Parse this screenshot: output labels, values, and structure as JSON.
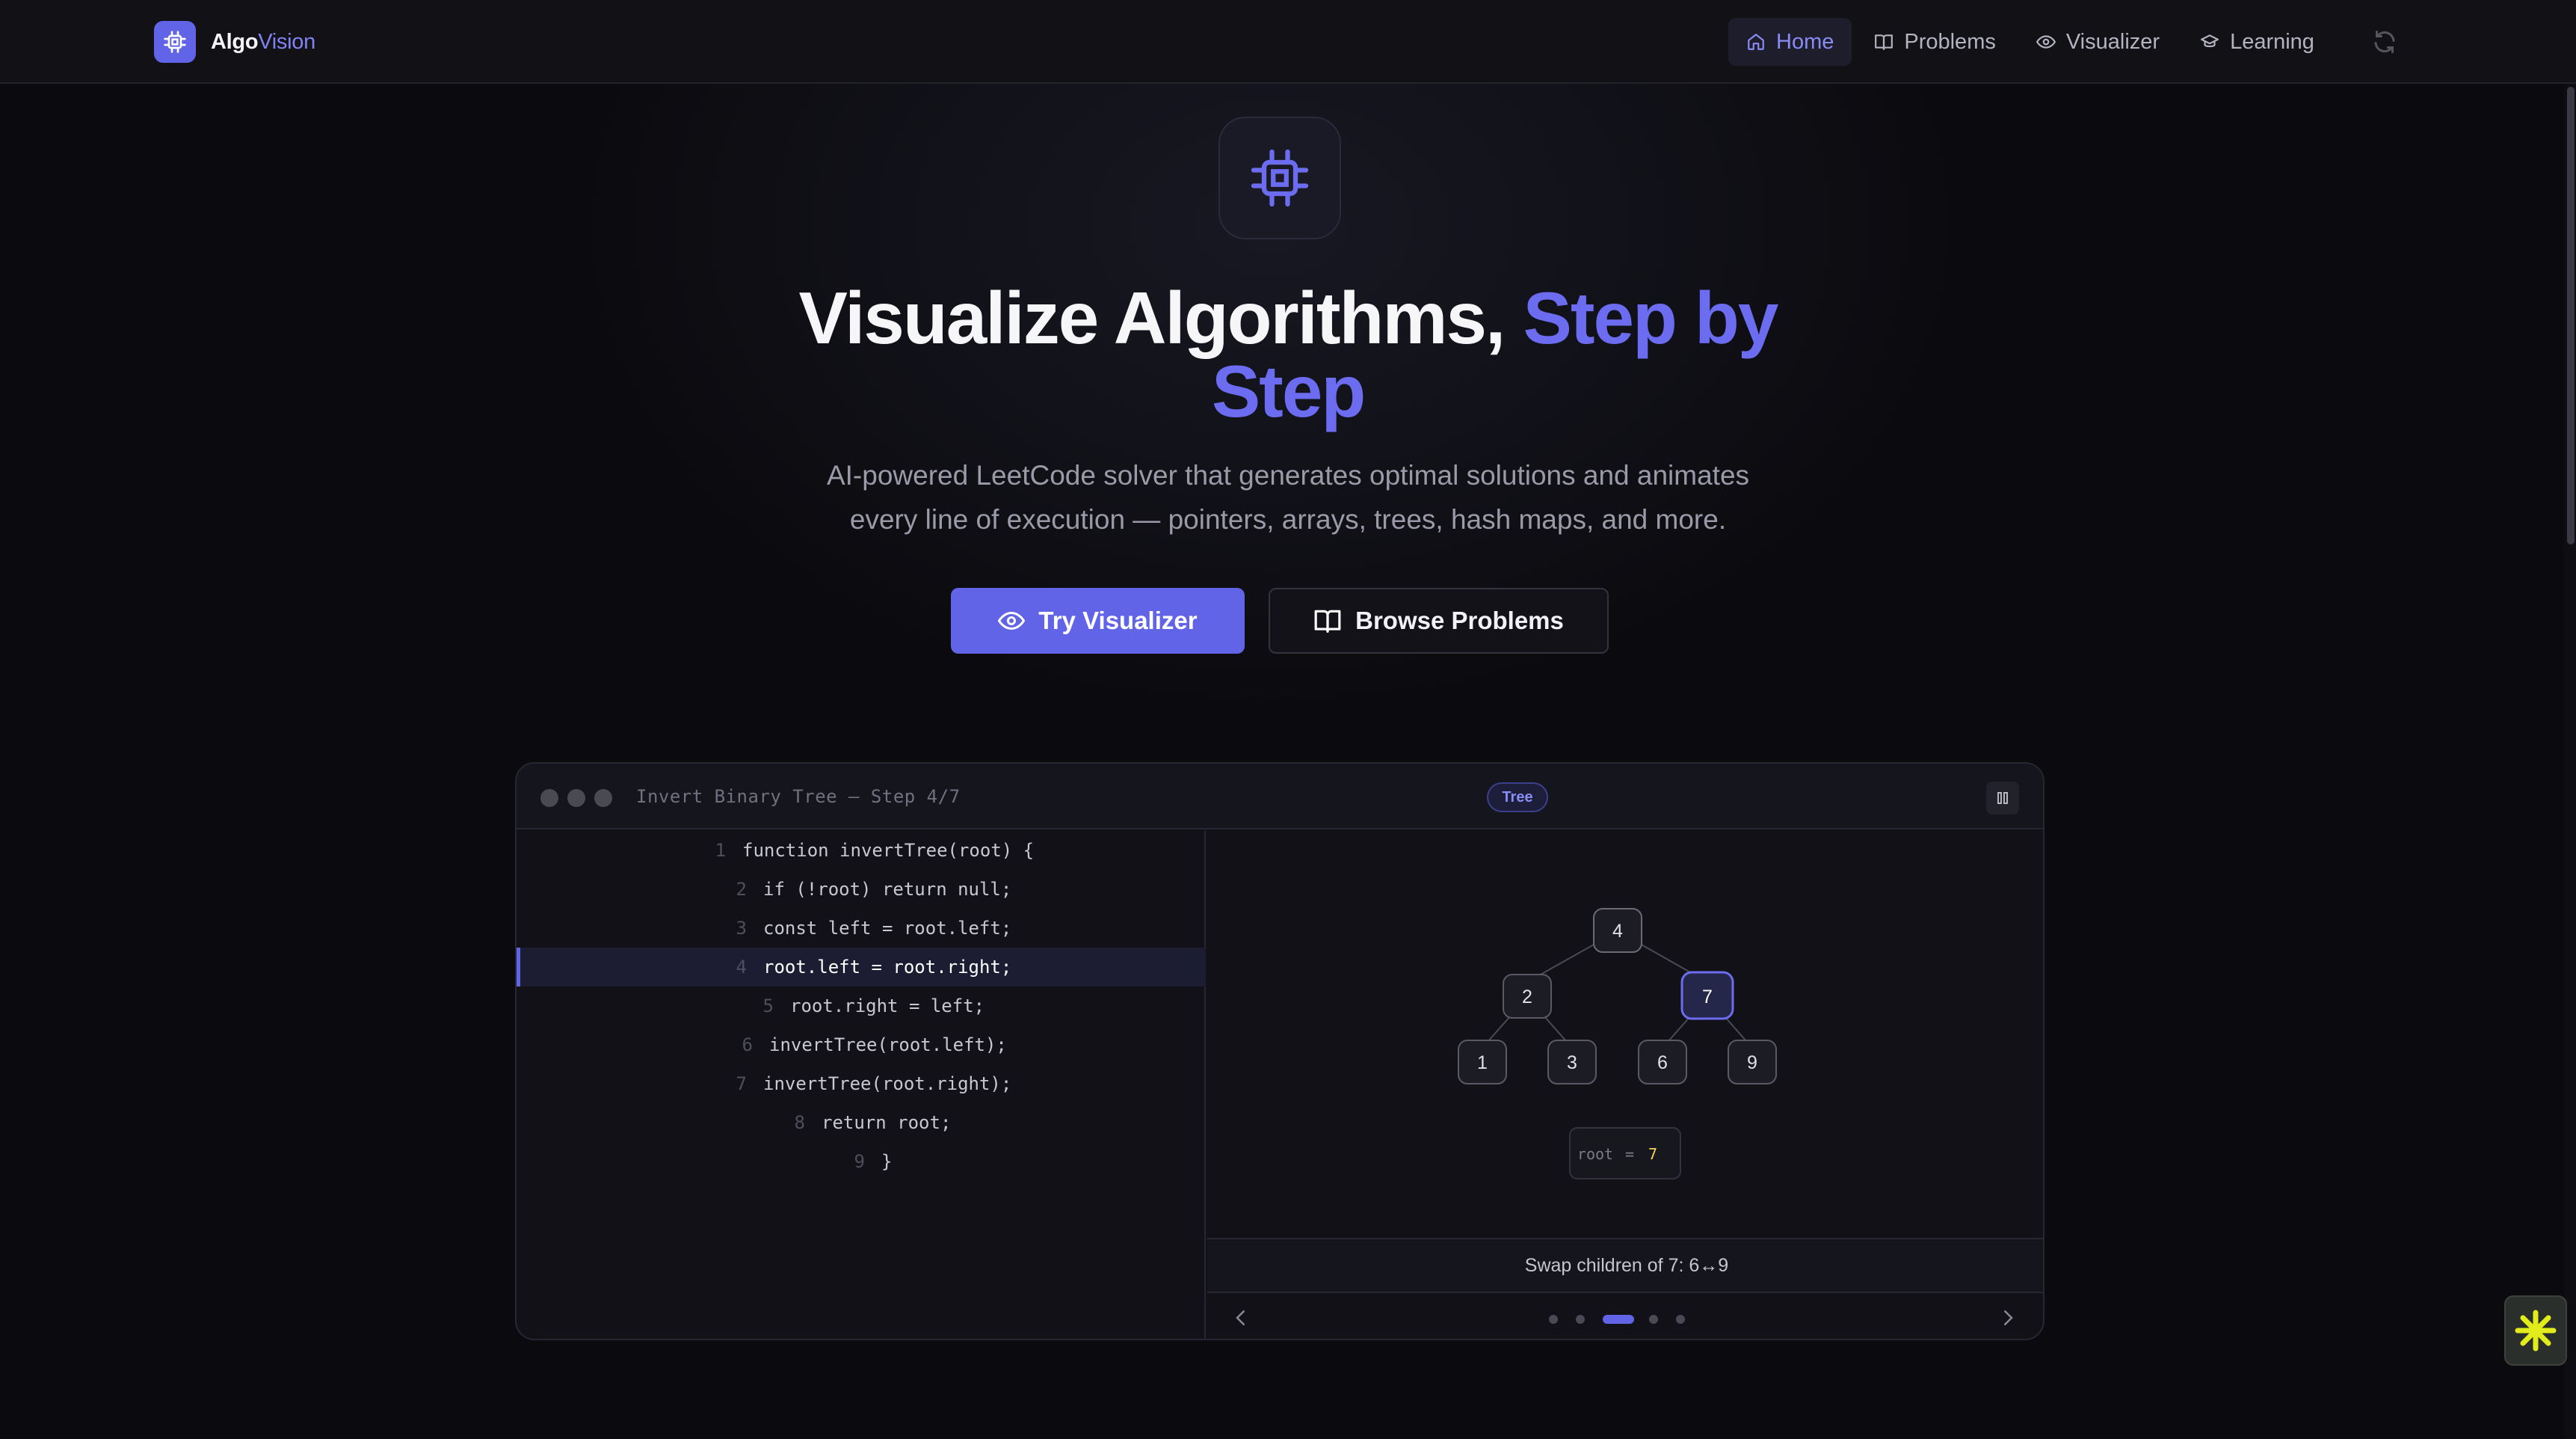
{
  "brand": {
    "name_part1": "Algo",
    "name_part2": "Vision"
  },
  "nav": {
    "items": [
      {
        "label": "Home",
        "icon": "home-icon",
        "active": true
      },
      {
        "label": "Problems",
        "icon": "book-icon",
        "active": false
      },
      {
        "label": "Visualizer",
        "icon": "eye-icon",
        "active": false
      },
      {
        "label": "Learning",
        "icon": "graduation-cap-icon",
        "active": false
      }
    ],
    "refresh_icon": "refresh-icon"
  },
  "hero": {
    "icon": "cpu-chip-icon",
    "headline_plain": "Visualize Algorithms, ",
    "headline_accent": "Step by Step",
    "subtitle_line1": "AI-powered LeetCode solver that generates optimal solutions and animates",
    "subtitle_line2": "every line of execution — pointers, arrays, trees, hash maps, and more.",
    "primary_button": "Try Visualizer",
    "secondary_button": "Browse Problems"
  },
  "demo": {
    "title": "Invert Binary Tree — Step 4/7",
    "tag": "Tree",
    "code": [
      {
        "n": "1",
        "text": "function invertTree(root) {"
      },
      {
        "n": "2",
        "text": "if (!root) return null;"
      },
      {
        "n": "3",
        "text": "const left = root.left;"
      },
      {
        "n": "4",
        "text": "root.left = root.right;"
      },
      {
        "n": "5",
        "text": "root.right = left;"
      },
      {
        "n": "6",
        "text": "invertTree(root.left);"
      },
      {
        "n": "7",
        "text": "invertTree(root.right);"
      },
      {
        "n": "8",
        "text": "return root;"
      },
      {
        "n": "9",
        "text": "}"
      }
    ],
    "highlighted_line": 4,
    "tree": {
      "nodes": [
        "4",
        "2",
        "7",
        "1",
        "3",
        "6",
        "9"
      ],
      "highlighted": "7"
    },
    "variable": {
      "name": "root",
      "eq": "=",
      "value": "7"
    },
    "status": "Swap children of 7: 6↔9",
    "steps_total": 5,
    "steps_active": 3
  },
  "colors": {
    "accent": "#6264e8",
    "accent_text": "#8a8cf6",
    "background": "#0b0b0f",
    "value_yellow": "#f2d25a"
  }
}
